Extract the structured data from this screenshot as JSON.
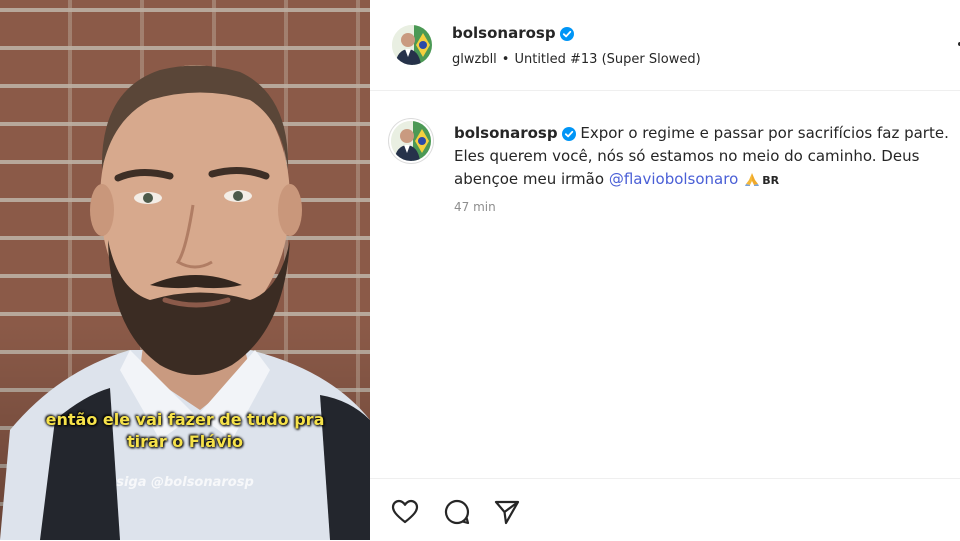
{
  "post": {
    "username": "bolsonarosp",
    "audio_user": "glwzbll",
    "audio_separator": "•",
    "audio_title": "Untitled #13 (Super Slowed)"
  },
  "media": {
    "caption_line1": "então ele vai fazer de tudo pra",
    "caption_line2": "tirar o Flávio",
    "watermark": "siga @bolsonarosp"
  },
  "comment": {
    "username": "bolsonarosp",
    "text": "Expor o regime e passar por sacrifícios faz parte. Eles querem você, nós só estamos no meio do caminho. Deus abençoe meu irmão",
    "mention": "@flaviobolsonaro",
    "flag_text": "BR",
    "time": "47 min"
  },
  "icons": {
    "verified": "verified-badge-icon",
    "like": "heart-icon",
    "comment": "comment-bubble-icon",
    "share": "send-icon",
    "more": "more-options-icon",
    "praying": "praying-hands-emoji"
  },
  "colors": {
    "verified": "#0095f6",
    "mention": "#4a5fd6",
    "caption": "#f6e24a",
    "muted": "#8e8e8e"
  }
}
